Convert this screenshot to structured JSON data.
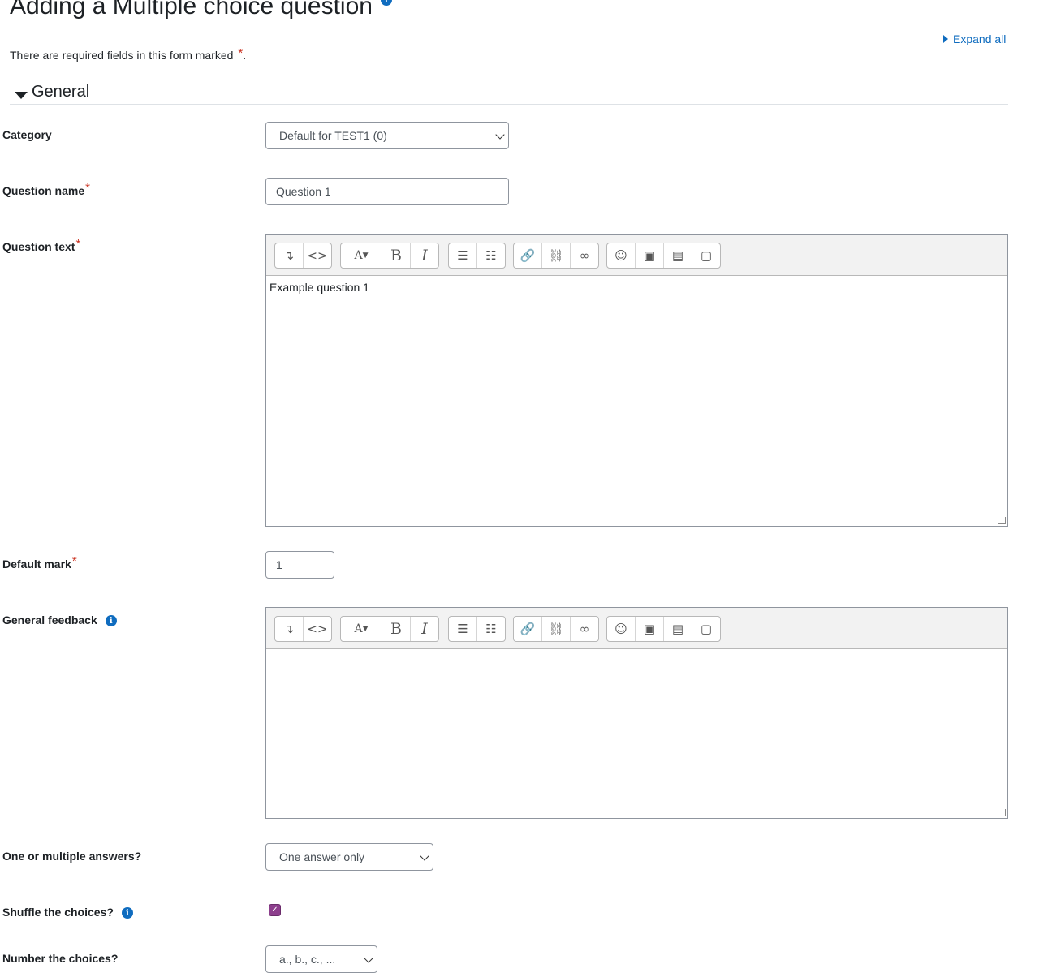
{
  "page": {
    "title": "Adding a Multiple choice question",
    "expand_all": "Expand all",
    "required_note": "There are required fields in this form marked",
    "required_marker": "*",
    "required_note_end": "."
  },
  "section": {
    "label": "General"
  },
  "fields": {
    "category": {
      "label": "Category",
      "value": "Default for TEST1 (0)"
    },
    "question_name": {
      "label": "Question name",
      "value": "Question 1"
    },
    "question_text": {
      "label": "Question text",
      "content": "Example question 1"
    },
    "default_mark": {
      "label": "Default mark",
      "value": "1"
    },
    "general_feedback": {
      "label": "General feedback",
      "content": ""
    },
    "single": {
      "label": "One or multiple answers?",
      "value": "One answer only"
    },
    "shuffle": {
      "label": "Shuffle the choices?",
      "checked": true
    },
    "numbering": {
      "label": "Number the choices?",
      "value": "a., b., c., ..."
    }
  },
  "toolbar_icons": [
    "collapse-toolbar-icon",
    "html-source-icon",
    "style-icon",
    "bold-icon",
    "italic-icon",
    "unordered-list-icon",
    "ordered-list-icon",
    "link-icon",
    "unlink-icon",
    "auto-link-icon",
    "emoticon-icon",
    "image-icon",
    "media-icon",
    "manage-files-icon"
  ],
  "colors": {
    "link": "#0f6cbf",
    "required": "#ca3120",
    "checkbox": "#8d3f8d",
    "toolbar_bg": "#f2f2f2"
  }
}
